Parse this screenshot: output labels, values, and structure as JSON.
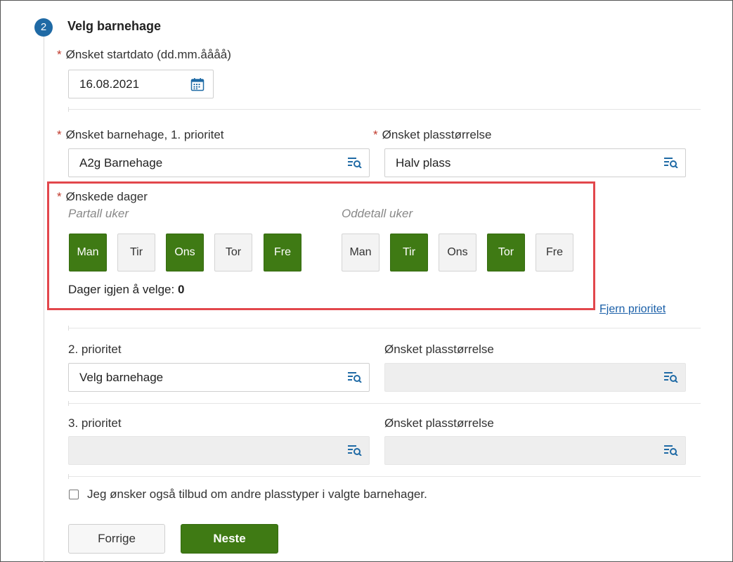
{
  "step": {
    "number": "2",
    "title": "Velg barnehage"
  },
  "start_date": {
    "label": "Ønsket startdato (dd.mm.åååå)",
    "value": "16.08.2021",
    "required": "*"
  },
  "priority1": {
    "label": "Ønsket barnehage, 1. prioritet",
    "value": "A2g Barnehage",
    "required": "*",
    "size_label": "Ønsket plasstørrelse",
    "size_value": "Halv plass",
    "size_required": "*"
  },
  "days": {
    "label": "Ønskede dager",
    "required": "*",
    "even_label": "Partall uker",
    "odd_label": "Oddetall uker",
    "even": [
      {
        "label": "Man",
        "selected": true
      },
      {
        "label": "Tir",
        "selected": false
      },
      {
        "label": "Ons",
        "selected": true
      },
      {
        "label": "Tor",
        "selected": false
      },
      {
        "label": "Fre",
        "selected": true
      }
    ],
    "odd": [
      {
        "label": "Man",
        "selected": false
      },
      {
        "label": "Tir",
        "selected": true
      },
      {
        "label": "Ons",
        "selected": false
      },
      {
        "label": "Tor",
        "selected": true
      },
      {
        "label": "Fre",
        "selected": false
      }
    ],
    "remaining_label": "Dager igjen å velge:",
    "remaining_value": "0"
  },
  "remove_priority": "Fjern prioritet",
  "priority2": {
    "label": "2. prioritet",
    "value": "Velg barnehage",
    "size_label": "Ønsket plasstørrelse",
    "size_value": ""
  },
  "priority3": {
    "label": "3. prioritet",
    "value": "",
    "size_label": "Ønsket plasstørrelse",
    "size_value": ""
  },
  "other_types_checkbox": {
    "label": "Jeg ønsker også tilbud om andre plasstyper i valgte barnehager.",
    "checked": false
  },
  "buttons": {
    "prev": "Forrige",
    "next": "Neste"
  },
  "colors": {
    "selected_day": "#3f7a14",
    "step_badge": "#1f6aa5",
    "required": "#c0392b",
    "link": "#1a5fa8",
    "highlight": "#e2474c"
  }
}
